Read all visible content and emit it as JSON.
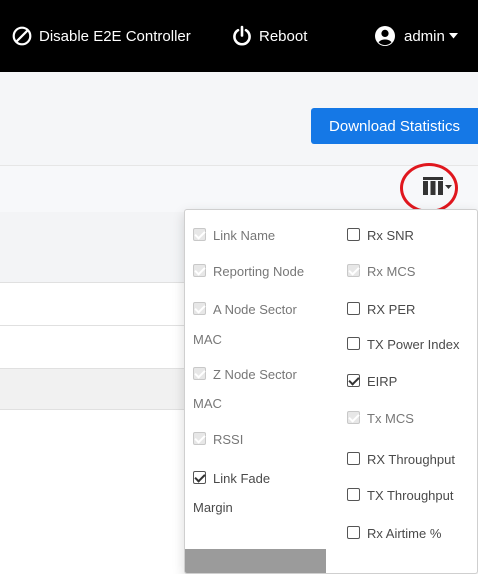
{
  "topbar": {
    "disable_e2e": "Disable E2E Controller",
    "reboot": "Reboot",
    "user": "admin"
  },
  "actions": {
    "download_statistics": "Download Statistics"
  },
  "columns_menu": {
    "left": [
      {
        "label": "Link Name",
        "state": "disabled_checked"
      },
      {
        "label": "Reporting Node",
        "state": "disabled_checked"
      },
      {
        "label": "A Node Sector",
        "label2": "MAC",
        "state": "disabled_checked"
      },
      {
        "label": "Z Node Sector",
        "label2": "MAC",
        "state": "disabled_checked"
      },
      {
        "label": "RSSI",
        "state": "disabled_checked"
      },
      {
        "label": "Link Fade",
        "label2": "Margin",
        "state": "checked"
      }
    ],
    "right": [
      {
        "label": "Rx SNR",
        "state": "unchecked"
      },
      {
        "label": "Rx MCS",
        "state": "disabled_checked"
      },
      {
        "label": "RX PER",
        "state": "unchecked"
      },
      {
        "label": "TX Power Index",
        "state": "unchecked"
      },
      {
        "label": "EIRP",
        "state": "checked"
      },
      {
        "label": "Tx MCS",
        "state": "disabled_checked"
      },
      {
        "label": "RX Throughput",
        "state": "unchecked"
      },
      {
        "label": "TX Throughput",
        "state": "unchecked"
      },
      {
        "label": "Rx Airtime %",
        "state": "unchecked"
      }
    ]
  },
  "colors": {
    "primary": "#1578e6",
    "annotation": "#e0171e",
    "topbar_bg": "#000000"
  },
  "icons": {
    "disable": "ban-icon",
    "reboot": "power-icon",
    "user": "user-circle-icon",
    "columns": "columns-icon"
  }
}
